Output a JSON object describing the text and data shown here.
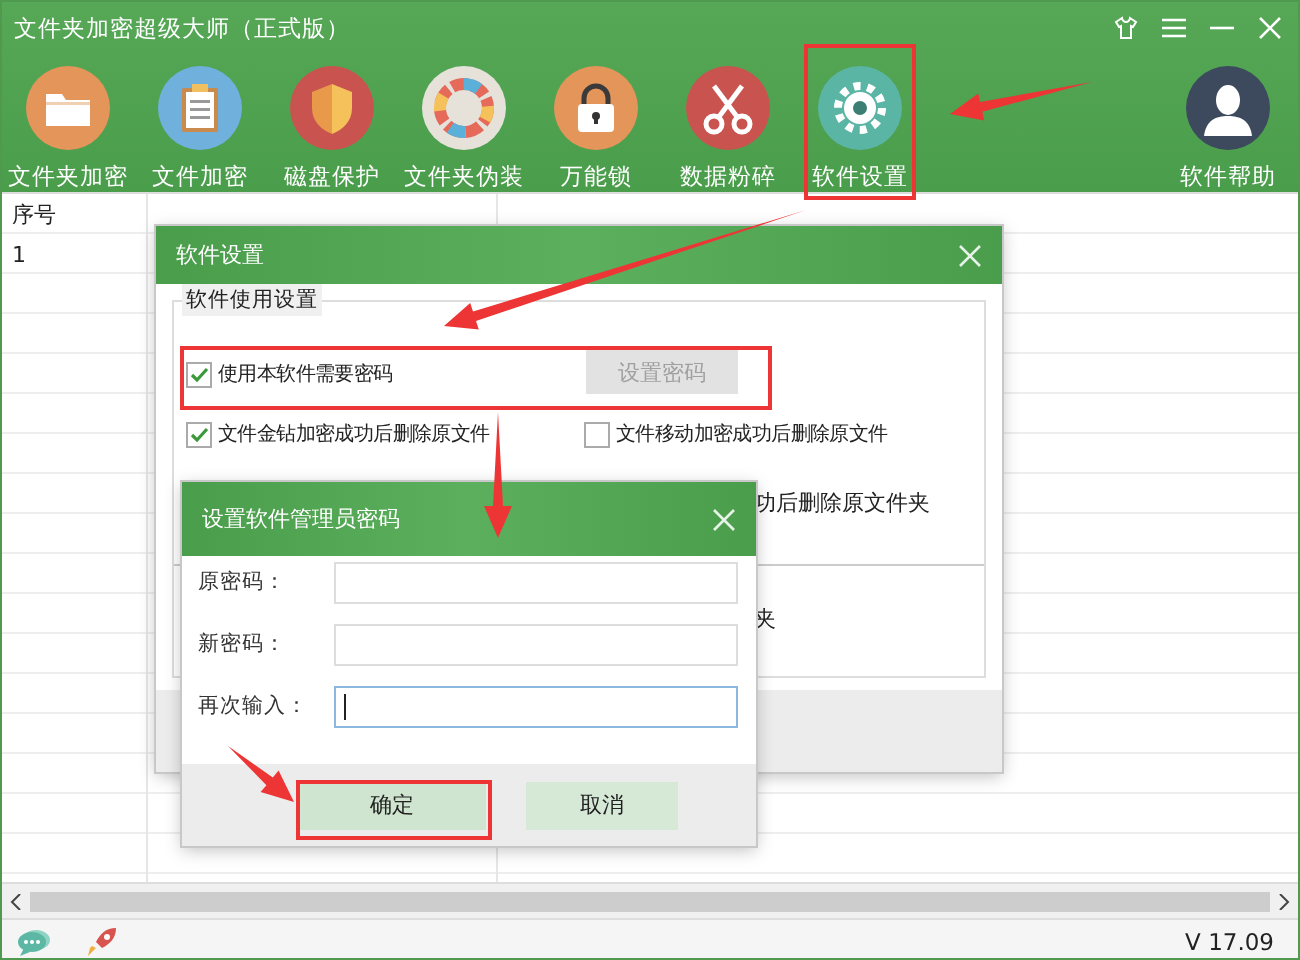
{
  "window": {
    "title": "文件夹加密超级大师（正式版）"
  },
  "toolbar": [
    {
      "label": "文件夹加密",
      "kind": "folder"
    },
    {
      "label": "文件加密",
      "kind": "clipboard"
    },
    {
      "label": "磁盘保护",
      "kind": "shield"
    },
    {
      "label": "文件夹伪装",
      "kind": "wheel"
    },
    {
      "label": "万能锁",
      "kind": "lock"
    },
    {
      "label": "数据粉碎",
      "kind": "scissors"
    },
    {
      "label": "软件设置",
      "kind": "gear"
    },
    {
      "label": "软件帮助",
      "kind": "user"
    }
  ],
  "table": {
    "columns": [
      "序号"
    ],
    "rows": [
      "1"
    ]
  },
  "settings_dialog": {
    "title": "软件设置",
    "group_title": "软件使用设置",
    "options": [
      {
        "label": "使用本软件需要密码",
        "checked": true
      },
      {
        "label": "文件金钻加密成功后删除原文件",
        "checked": true
      },
      {
        "label": "文件移动加密成功后删除原文件",
        "checked": false
      }
    ],
    "set_password_button": {
      "label": "设置密码",
      "disabled": true
    },
    "partial_texts": [
      "功后删除原文件夹",
      "夹"
    ]
  },
  "password_dialog": {
    "title": "设置软件管理员密码",
    "fields": [
      {
        "label": "原密码：",
        "focused": false
      },
      {
        "label": "新密码：",
        "focused": false
      },
      {
        "label": "再次输入：",
        "focused": true
      }
    ],
    "buttons": [
      {
        "label": "确定",
        "kind": "confirm"
      },
      {
        "label": "取消",
        "kind": "cancel"
      }
    ]
  },
  "status_bar": {
    "version": "V 17.09"
  }
}
